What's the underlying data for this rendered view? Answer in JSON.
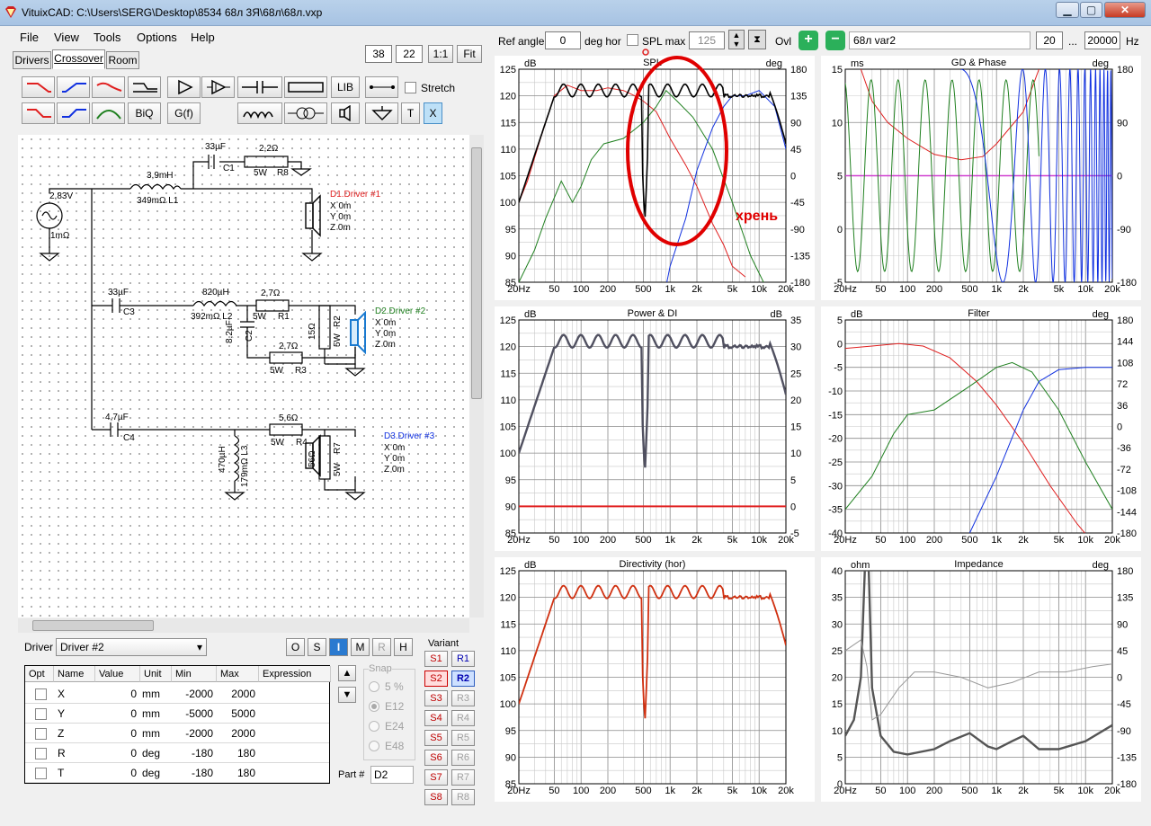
{
  "window": {
    "title": "VituixCAD: C:\\Users\\SERG\\Desktop\\8534 68л 3Я\\68л\\68л.vxp"
  },
  "menu": [
    "File",
    "View",
    "Tools",
    "Options",
    "Help"
  ],
  "tabs": [
    "Drivers",
    "Crossover",
    "Room"
  ],
  "header_boxes": {
    "w": "38",
    "h": "22",
    "ratio": "1:1",
    "fit": "Fit"
  },
  "toolbar": {
    "lib": "LIB",
    "biq": "BiQ",
    "gf": "G(f)",
    "t": "T",
    "x": "X",
    "stretch": "Stretch"
  },
  "top_controls": {
    "ref_angle_label": "Ref angle",
    "ref_angle": "0",
    "deg_hor": "deg hor",
    "spl_max_label": "SPL max",
    "spl_max": "125",
    "ovl": "Ovl",
    "variant_name": "68л var2",
    "f_min": "20",
    "dots": "...",
    "f_max": "20000",
    "hz": "Hz"
  },
  "schematic": {
    "source_v": "2,83V",
    "source_r": "1mΩ",
    "c1": "33µF",
    "c1_name": "C1",
    "r8": "2,2Ω",
    "r8_name": "R8",
    "r8_w": "5W",
    "l1": "3,9mH",
    "l1_sub": "349mΩ L1",
    "d1": "D1.Driver #1",
    "d2": "D2.Driver #2",
    "d3": "D3.Driver #3",
    "pos": [
      "X 0m",
      "Y 0m",
      "Z 0m"
    ],
    "c3": "33µF",
    "c3_name": "C3",
    "l2": "820µH",
    "l2_sub": "392mΩ L2",
    "r1": "2,7Ω",
    "r1_name": "R1",
    "r1_w": "5W",
    "c2": "8,2µF",
    "c2_name": "C2",
    "r2": "15Ω",
    "r2_name": "R2",
    "r2_w": "5W",
    "r3": "2,7Ω",
    "r3_name": "R3",
    "r3_w": "5W",
    "c4": "4,7µF",
    "c4_name": "C4",
    "r4": "5,6Ω",
    "r4_name": "R4",
    "r4_w": "5W",
    "l3": "470µH",
    "l3_sub": "179mΩ L3",
    "r7": "56Ω",
    "r7_name": "R7",
    "r7_w": "5W"
  },
  "driver_row": {
    "label": "Driver",
    "value": "Driver #2",
    "buttons": [
      "O",
      "S",
      "I",
      "M",
      "R",
      "H"
    ]
  },
  "opt_table": {
    "headers": [
      "Opt",
      "Name",
      "Value",
      "Unit",
      "Min",
      "Max",
      "Expression"
    ],
    "rows": [
      {
        "name": "X",
        "value": "0",
        "unit": "mm",
        "min": "-2000",
        "max": "2000"
      },
      {
        "name": "Y",
        "value": "0",
        "unit": "mm",
        "min": "-5000",
        "max": "5000"
      },
      {
        "name": "Z",
        "value": "0",
        "unit": "mm",
        "min": "-2000",
        "max": "2000"
      },
      {
        "name": "R",
        "value": "0",
        "unit": "deg",
        "min": "-180",
        "max": "180"
      },
      {
        "name": "T",
        "value": "0",
        "unit": "deg",
        "min": "-180",
        "max": "180"
      }
    ]
  },
  "snap": {
    "label": "Snap",
    "options": [
      "5 %",
      "E12",
      "E24",
      "E48"
    ]
  },
  "part": {
    "label": "Part #",
    "value": "D2"
  },
  "variant": {
    "label": "Variant",
    "s": [
      "S1",
      "S2",
      "S3",
      "S4",
      "S5",
      "S6",
      "S7",
      "S8"
    ],
    "r": [
      "R1",
      "R2",
      "R3",
      "R4",
      "R5",
      "R6",
      "R7",
      "R8"
    ]
  },
  "colors": {
    "red": "#e02020",
    "green": "#208020",
    "blue": "#1030e0",
    "black": "#000000",
    "navy": "#101070",
    "grey": "#505060",
    "orange": "#d03010"
  },
  "charts": [
    {
      "title": "SPL",
      "yl": "dB",
      "yr": "deg",
      "ly": [
        "125",
        "120",
        "115",
        "110",
        "105",
        "100",
        "95",
        "90",
        "85"
      ],
      "ry": [
        "180",
        "135",
        "90",
        "45",
        "0",
        "-45",
        "-90",
        "-135",
        "-180"
      ],
      "x": [
        "20Hz",
        "50",
        "100",
        "200",
        "500",
        "1k",
        "2k",
        "5k",
        "10k",
        "20k"
      ],
      "annotation": "хрень"
    },
    {
      "title": "GD & Phase",
      "yl": "ms",
      "yr": "deg",
      "ly": [
        "15",
        "10",
        "5",
        "0",
        "-5"
      ],
      "ry": [
        "180",
        "90",
        "0",
        "-90",
        "-180"
      ],
      "x": [
        "20Hz",
        "50",
        "100",
        "200",
        "500",
        "1k",
        "2k",
        "5k",
        "10k",
        "20k"
      ]
    },
    {
      "title": "Power & DI",
      "yl": "dB",
      "yr": "dB",
      "ly": [
        "125",
        "120",
        "115",
        "110",
        "105",
        "100",
        "95",
        "90",
        "85"
      ],
      "ry": [
        "35",
        "30",
        "25",
        "20",
        "15",
        "10",
        "5",
        "0",
        "-5"
      ],
      "x": [
        "20Hz",
        "50",
        "100",
        "200",
        "500",
        "1k",
        "2k",
        "5k",
        "10k",
        "20k"
      ]
    },
    {
      "title": "Filter",
      "yl": "dB",
      "yr": "deg",
      "ly": [
        "5",
        "0",
        "-5",
        "-10",
        "-15",
        "-20",
        "-25",
        "-30",
        "-35",
        "-40"
      ],
      "ry": [
        "180",
        "144",
        "108",
        "72",
        "36",
        "0",
        "-36",
        "-72",
        "-108",
        "-144",
        "-180"
      ],
      "x": [
        "20Hz",
        "50",
        "100",
        "200",
        "500",
        "1k",
        "2k",
        "5k",
        "10k",
        "20k"
      ]
    },
    {
      "title": "Directivity (hor)",
      "yl": "dB",
      "yr": "",
      "ly": [
        "125",
        "120",
        "115",
        "110",
        "105",
        "100",
        "95",
        "90",
        "85"
      ],
      "ry": [],
      "x": [
        "20Hz",
        "50",
        "100",
        "200",
        "500",
        "1k",
        "2k",
        "5k",
        "10k",
        "20k"
      ]
    },
    {
      "title": "Impedance",
      "yl": "ohm",
      "yr": "deg",
      "ly": [
        "40",
        "35",
        "30",
        "25",
        "20",
        "15",
        "10",
        "5",
        "0"
      ],
      "ry": [
        "180",
        "135",
        "90",
        "45",
        "0",
        "-45",
        "-90",
        "-135",
        "-180"
      ],
      "x": [
        "20Hz",
        "50",
        "100",
        "200",
        "500",
        "1k",
        "2k",
        "5k",
        "10k",
        "20k"
      ]
    }
  ]
}
